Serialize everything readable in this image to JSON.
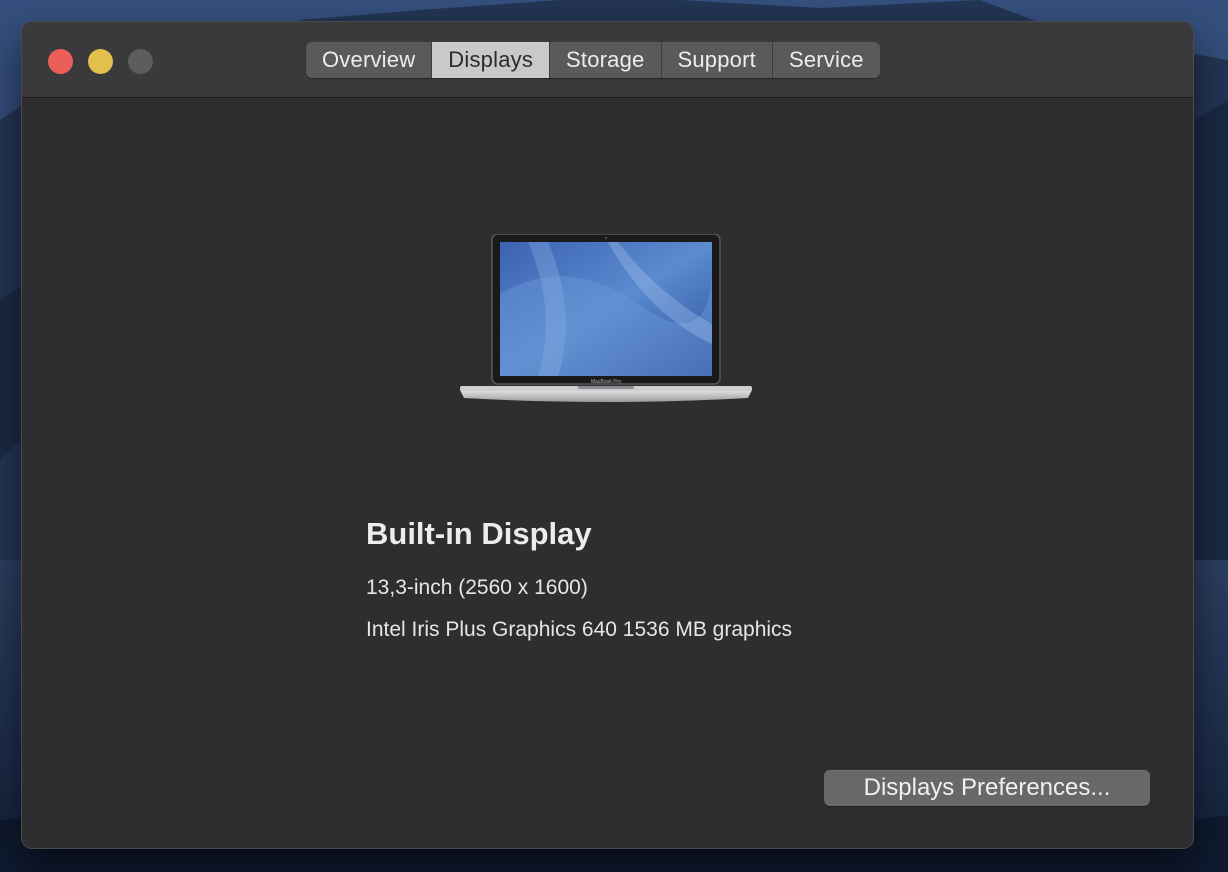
{
  "window": {
    "tabs": [
      {
        "label": "Overview"
      },
      {
        "label": "Displays"
      },
      {
        "label": "Storage"
      },
      {
        "label": "Support"
      },
      {
        "label": "Service"
      }
    ],
    "active_tab": "Displays"
  },
  "display": {
    "title": "Built-in Display",
    "size_resolution": "13,3-inch (2560 x 1600)",
    "graphics": "Intel Iris Plus Graphics 640 1536 MB graphics",
    "laptop_logo": "MacBook Pro"
  },
  "actions": {
    "preferences_button": "Displays Preferences..."
  },
  "colors": {
    "window_bg": "#2e2e30",
    "titlebar_bg": "#3a3a3c",
    "close": "#ec5f58",
    "minimize": "#e3bf4c",
    "zoom_disabled": "#5d5d5f",
    "active_tab_bg": "#c9c9cb"
  },
  "icons": [
    "close-icon",
    "minimize-icon",
    "zoom-icon",
    "laptop-icon"
  ]
}
